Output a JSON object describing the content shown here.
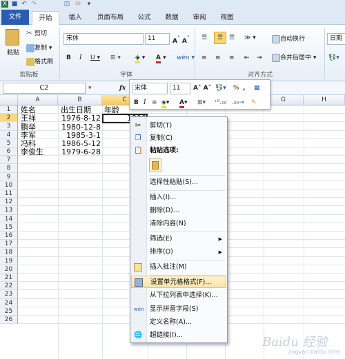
{
  "tabs": [
    "文件",
    "开始",
    "插入",
    "页面布局",
    "公式",
    "数据",
    "审阅",
    "视图"
  ],
  "ribbon": {
    "paste_label": "粘贴",
    "cut_label": "剪切",
    "copy_label": "复制",
    "format_painter_label": "格式刷",
    "clipboard_group": "剪贴板",
    "font_name": "宋体",
    "font_size": "11",
    "font_group": "字体",
    "wrap_text_label": "自动换行",
    "merge_center_label": "合并后居中",
    "alignment_group": "对齐方式",
    "number_format": "日期"
  },
  "formula_bar": {
    "name_box": "C2",
    "fx_label": "fx"
  },
  "columns": [
    "A",
    "B",
    "C",
    "D",
    "E",
    "F",
    "G",
    "H"
  ],
  "rows": [
    "1",
    "2",
    "3",
    "4",
    "5",
    "6",
    "7",
    "8",
    "9",
    "10",
    "11",
    "12",
    "13",
    "14",
    "15",
    "16",
    "17",
    "18",
    "19",
    "20",
    "21",
    "22",
    "23",
    "24",
    "25",
    "26"
  ],
  "table": [
    {
      "name": "姓名",
      "dob": "出生日期",
      "age": "年龄"
    },
    {
      "name": "王祥",
      "dob": "1976-8-12",
      "age": "1900"
    },
    {
      "name": "鹏举",
      "dob": "1980-12-8",
      "age": ""
    },
    {
      "name": "李军",
      "dob": "1985-3-1",
      "age": ""
    },
    {
      "name": "冯科",
      "dob": "1986-5-12",
      "age": ""
    },
    {
      "name": "李俊生",
      "dob": "1979-6-28",
      "age": ""
    }
  ],
  "mini_toolbar": {
    "font_name": "宋体",
    "font_size": "11",
    "percent": "%",
    "comma": ","
  },
  "context_menu": {
    "cut": "剪切(T)",
    "copy": "复制(C)",
    "paste_options": "粘贴选项:",
    "paste_special": "选择性粘贴(S)...",
    "insert": "插入(I)...",
    "delete": "删除(D)...",
    "clear": "清除内容(N)",
    "filter": "筛选(E)",
    "sort": "排序(O)",
    "insert_comment": "插入批注(M)",
    "format_cells": "设置单元格格式(F)...",
    "pick_from_list": "从下拉列表中选择(K)...",
    "phonetic": "显示拼音字段(S)",
    "define_name": "定义名称(A)...",
    "hyperlink": "超链接(I)..."
  },
  "watermark": "Baidu 经验",
  "watermark_url": "jingyan.baidu.com",
  "colors": {
    "file_tab": "#2a5db0",
    "highlight": "#fbe3a4",
    "selected_header": "#f6c85e"
  }
}
